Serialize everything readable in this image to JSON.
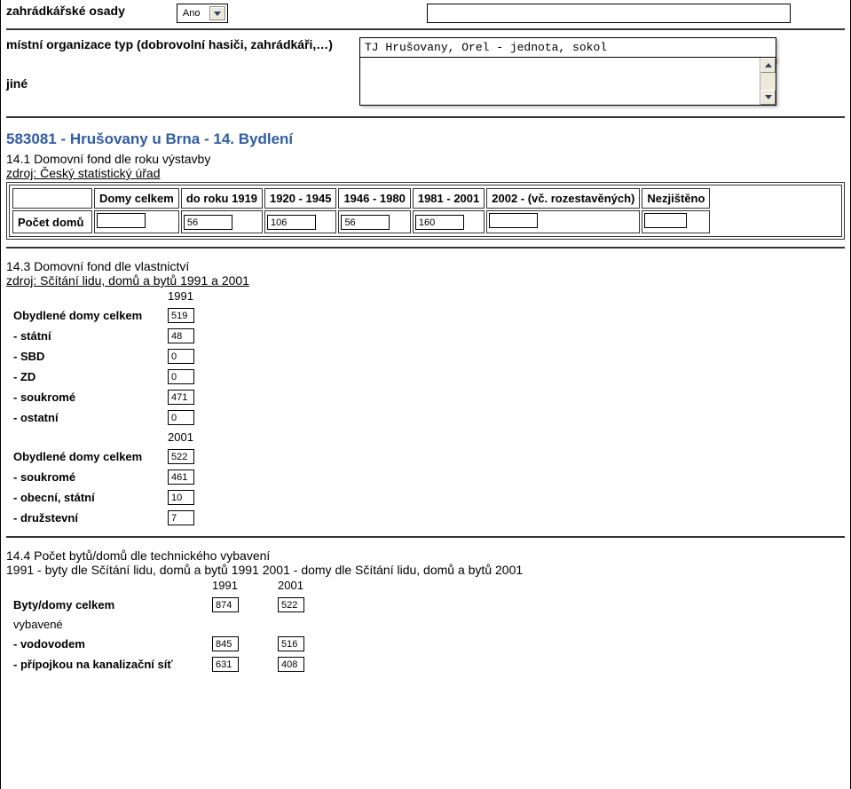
{
  "top": {
    "label_osady": "zahrádkářské osady",
    "osady_value": "Ano",
    "label_org": "místní organizace typ (dobrovolní hasiči, zahrádkáři,…)",
    "org_value": "TJ Hrušovany, Orel - jednota, sokol",
    "label_jine": "jiné",
    "jine_value": ""
  },
  "section_title": "583081 - Hrušovany u Brna - 14. Bydlení",
  "s141": {
    "title": "14.1 Domovní fond dle roku výstavby",
    "source": "zdroj: Český statistický úřad",
    "headers": [
      "",
      "Domy celkem",
      "do roku 1919",
      "1920 - 1945",
      "1946 - 1980",
      "1981 - 2001",
      "2002 - (vč. rozestavěných)",
      "Nezjištěno"
    ],
    "row_label": "Počet domů",
    "values": [
      "",
      "56",
      "106",
      "56",
      "160",
      "",
      ""
    ]
  },
  "s143": {
    "title": "14.3 Domovní fond dle vlastnictví",
    "source": "zdroj: Sčítání lidu, domů a bytů 1991 a 2001",
    "year1": "1991",
    "year2": "2001",
    "rows1": [
      {
        "label": "Obydlené domy celkem",
        "val": "519"
      },
      {
        "label": "- státní",
        "val": "48"
      },
      {
        "label": "- SBD",
        "val": "0"
      },
      {
        "label": "- ZD",
        "val": "0"
      },
      {
        "label": "- soukromé",
        "val": "471"
      },
      {
        "label": "- ostatní",
        "val": "0"
      }
    ],
    "rows2": [
      {
        "label": "Obydlené domy celkem",
        "val": "522"
      },
      {
        "label": "- soukromé",
        "val": "461"
      },
      {
        "label": "- obecní, státní",
        "val": "10"
      },
      {
        "label": "- družstevní",
        "val": "7"
      }
    ]
  },
  "s144": {
    "title": "14.4 Počet bytů/domů dle technického vybavení",
    "source": "1991 - byty dle Sčítání lidu, domů a bytů 1991 2001 - domy dle Sčítání lidu, domů a bytů 2001",
    "year1": "1991",
    "year2": "2001",
    "rows": [
      {
        "label": "Byty/domy celkem",
        "v1": "874",
        "v2": "522"
      },
      {
        "label": "vybavené",
        "v1": null,
        "v2": null
      },
      {
        "label": "- vodovodem",
        "v1": "845",
        "v2": "516"
      },
      {
        "label": "- přípojkou na kanalizační síť",
        "v1": "631",
        "v2": "408"
      }
    ]
  }
}
